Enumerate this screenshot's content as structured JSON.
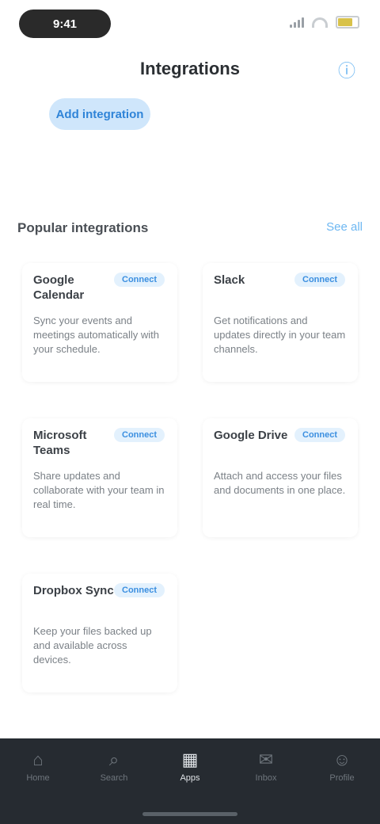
{
  "status_bar": {
    "time": "9:41",
    "battery_level": 0.75,
    "icons": [
      "signal-icon",
      "wifi-icon",
      "battery-icon"
    ],
    "battery_color": "#d8c24a"
  },
  "header": {
    "title": "Integrations",
    "help_icon": "question-circle-icon"
  },
  "primary_action": {
    "label": "Add integration"
  },
  "section": {
    "title": "Popular integrations",
    "link_label": "See all"
  },
  "cards": [
    {
      "title": "Google Calendar",
      "badge": "Connect",
      "description": "Sync your events and meetings automatically with your schedule."
    },
    {
      "title": "Slack",
      "badge": "Connect",
      "description": "Get notifications and updates directly in your team channels."
    },
    {
      "title": "Microsoft Teams",
      "badge": "Connect",
      "description": "Share updates and collaborate with your team in real time."
    },
    {
      "title": "Google Drive",
      "badge": "Connect",
      "description": "Attach and access your files and documents in one place."
    },
    {
      "title": "Dropbox Sync",
      "badge": "Connect",
      "description": "Keep your files backed up and available across devices."
    }
  ],
  "tab_bar": {
    "items": [
      {
        "label": "Home",
        "icon": "home-icon",
        "glyph": "⌂"
      },
      {
        "label": "Search",
        "icon": "search-icon",
        "glyph": "⌕"
      },
      {
        "label": "Apps",
        "icon": "grid-icon",
        "glyph": "▦"
      },
      {
        "label": "Inbox",
        "icon": "inbox-icon",
        "glyph": "✉"
      },
      {
        "label": "Profile",
        "icon": "user-icon",
        "glyph": "☺"
      }
    ],
    "active_index": 2
  },
  "colors": {
    "accent": "#6db7f2",
    "primary_button_bg": "#cfe6fb",
    "tab_bar_bg": "#262b31"
  }
}
